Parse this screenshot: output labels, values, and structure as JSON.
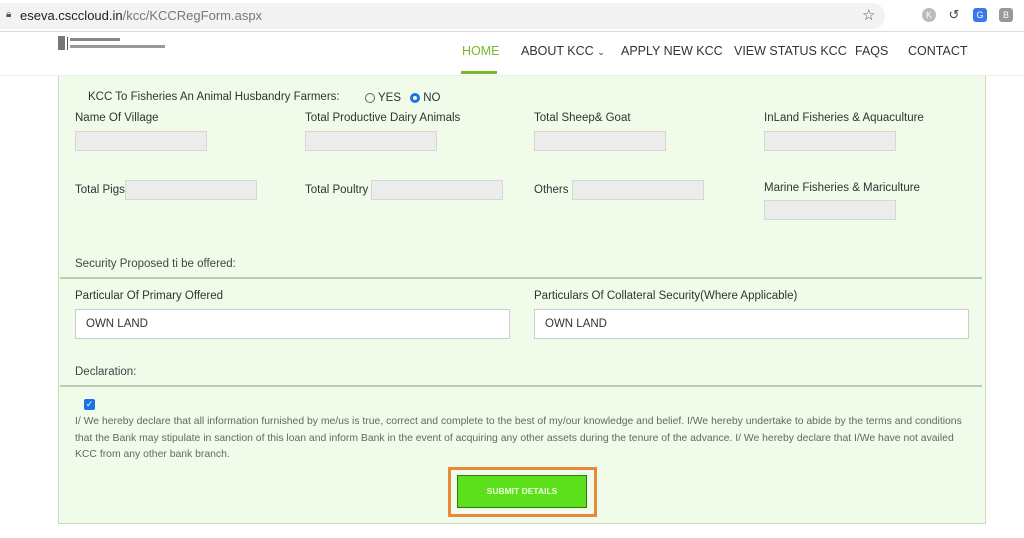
{
  "browser": {
    "url_host": "eseva.csccloud.in",
    "url_path": "/kcc/KCCRegForm.aspx"
  },
  "header": {
    "logo_text": "Ministry of Agriculture & Farmers Welfare",
    "nav": [
      "HOME",
      "ABOUT KCC",
      "APPLY NEW KCC",
      "VIEW STATUS KCC",
      "FAQS",
      "CONTACT"
    ],
    "active": "HOME",
    "accent": "#76b82a"
  },
  "form": {
    "fisheries_question": "KCC To Fisheries An Animal Husbandry Farmers:",
    "yes": "YES",
    "no": "NO",
    "selected": "NO",
    "name_of_village": "Name Of Village",
    "total_dairy": "Total Productive Dairy Animals",
    "total_sheep": "Total Sheep& Goat",
    "inland": "InLand Fisheries & Aquaculture",
    "total_pigs": "Total Pigs",
    "total_poultry": "Total Poultry",
    "others": "Others",
    "marine": "Marine Fisheries & Mariculture",
    "security_heading": "Security Proposed ti be offered:",
    "primary_label": "Particular Of Primary Offered",
    "primary_value": "OWN LAND",
    "collateral_label": "Particulars Of Collateral Security(Where Applicable)",
    "collateral_value": "OWN LAND",
    "declaration_heading": "Declaration:",
    "declaration_checked": true,
    "declaration_text": "I/ We hereby declare that all information furnished by me/us is true, correct and complete to the best of my/our knowledge and belief. I/We hereby undertake to abide by the terms and conditions that the Bank may stipulate in sanction of this loan and inform Bank in the event of acquiring any other assets during the tenure of the advance. I/ We hereby declare that I/We have not availed KCC from any other bank branch.",
    "submit": "SUBMIT DETAILS"
  }
}
